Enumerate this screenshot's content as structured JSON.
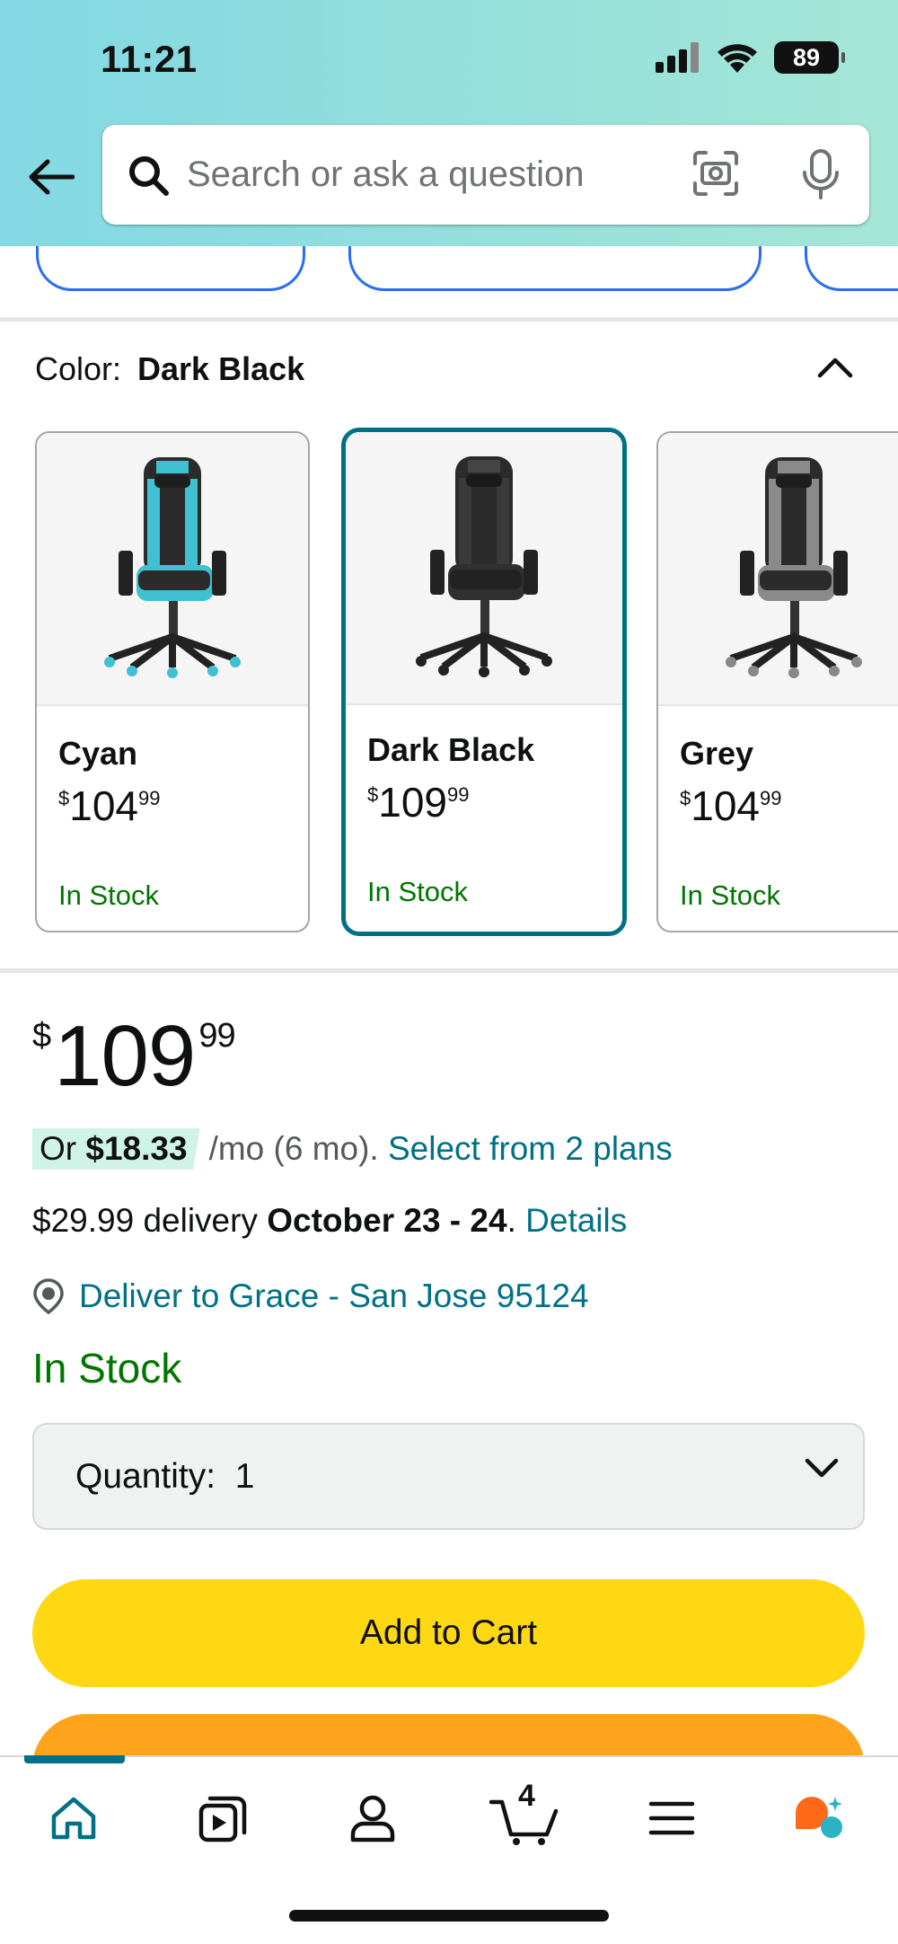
{
  "status_bar": {
    "time": "11:21",
    "battery": "89"
  },
  "search": {
    "placeholder": "Search or ask a question"
  },
  "variation": {
    "label": "Color:",
    "selected": "Dark Black",
    "options": [
      {
        "name": "Cyan",
        "currency": "$",
        "whole": "104",
        "cents": "99",
        "stock": "In Stock",
        "accent": "#3fc1d2"
      },
      {
        "name": "Dark Black",
        "currency": "$",
        "whole": "109",
        "cents": "99",
        "stock": "In Stock",
        "accent": "#2b2b2b"
      },
      {
        "name": "Grey",
        "currency": "$",
        "whole": "104",
        "cents": "99",
        "stock": "In Stock",
        "accent": "#8a8a8a"
      }
    ]
  },
  "price": {
    "currency": "$",
    "whole": "109",
    "cents": "99"
  },
  "installment": {
    "or": "Or",
    "amount": "$18.33",
    "term": "/mo (6 mo).",
    "link": "Select from 2 plans"
  },
  "delivery": {
    "fee": "$29.99 delivery",
    "dates": "October 23 - 24",
    "sep": ".",
    "details_link": "Details"
  },
  "deliver_to": "Deliver to Grace - San Jose 95124",
  "availability": "In Stock",
  "quantity": {
    "label": "Quantity:",
    "value": "1"
  },
  "buttons": {
    "add_to_cart": "Add to Cart"
  },
  "bottom_nav": {
    "cart_count": "4"
  },
  "colors": {
    "link": "#007185",
    "in_stock": "#007600",
    "add_to_cart_bg": "#ffd814",
    "buy_now_bg": "#ffa41c",
    "selected_border": "#007185"
  }
}
